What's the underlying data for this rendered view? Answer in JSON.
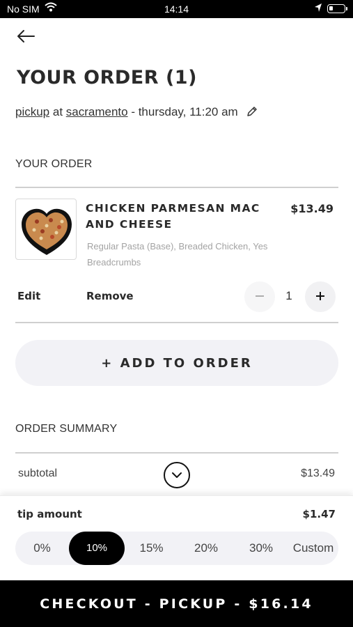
{
  "status_bar": {
    "carrier": "No SIM",
    "time": "14:14"
  },
  "header": {
    "title": "YOUR ORDER (1)"
  },
  "pickup": {
    "method": "pickup",
    "at": " at ",
    "location": "sacramento",
    "datetime": " - thursday, 11:20 am"
  },
  "order": {
    "section_label": "YOUR ORDER",
    "items": [
      {
        "name": "CHICKEN PARMESAN MAC AND CHEESE",
        "price": "$13.49",
        "options": "Regular Pasta (Base), Breaded Chicken, Yes Breadcrumbs",
        "edit_label": "Edit",
        "remove_label": "Remove",
        "quantity": "1"
      }
    ],
    "add_button": "+ ADD TO ORDER"
  },
  "summary": {
    "section_label": "ORDER SUMMARY",
    "subtotal_label": "subtotal",
    "subtotal_value": "$13.49"
  },
  "tip": {
    "label": "tip amount",
    "value": "$1.47",
    "options": [
      "0%",
      "10%",
      "15%",
      "20%",
      "30%",
      "Custom"
    ],
    "selected": "10%"
  },
  "checkout": {
    "label": "CHECKOUT - PICKUP - $16.14"
  },
  "colors": {
    "primary": "#000000",
    "pill_bg": "#f2f2f6",
    "muted_text": "#a3a3a3"
  },
  "icons": {
    "back": "arrow-left-icon",
    "edit_pickup": "pencil-icon",
    "qty_minus": "minus-icon",
    "qty_plus": "plus-icon",
    "expand": "chevron-down-icon"
  }
}
